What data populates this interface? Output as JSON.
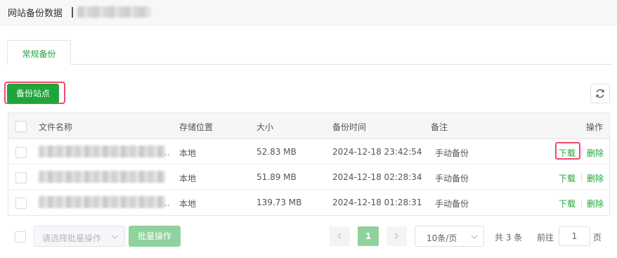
{
  "header": {
    "title": "网站备份数据"
  },
  "tabs": [
    {
      "label": "常规备份"
    }
  ],
  "toolbar": {
    "backup_button": "备份站点",
    "refresh_icon": "refresh-icon"
  },
  "table": {
    "columns": [
      "文件名称",
      "存储位置",
      "大小",
      "备份时间",
      "备注",
      "操作"
    ],
    "rows": [
      {
        "name_suffix": "..",
        "location": "本地",
        "size": "52.83 MB",
        "time": "2024-12-18 23:42:54",
        "note": "手动备份",
        "download": "下载",
        "delete": "删除"
      },
      {
        "name_suffix": "",
        "location": "本地",
        "size": "51.89 MB",
        "time": "2024-12-18 02:28:34",
        "note": "手动备份",
        "download": "下载",
        "delete": "删除"
      },
      {
        "name_suffix": "..",
        "location": "本地",
        "size": "139.73 MB",
        "time": "2024-12-18 01:28:31",
        "note": "手动备份",
        "download": "下载",
        "delete": "删除"
      }
    ]
  },
  "footer": {
    "batch_placeholder": "请选择批量操作",
    "batch_button": "批量操作",
    "current_page": "1",
    "page_size": "10条/页",
    "total": "共 3 条",
    "goto_label": "前往",
    "goto_value": "1",
    "page_unit": "页"
  },
  "colors": {
    "accent": "#20a53a",
    "accent_disabled": "#90d29d",
    "highlight": "#ef4b6d"
  }
}
